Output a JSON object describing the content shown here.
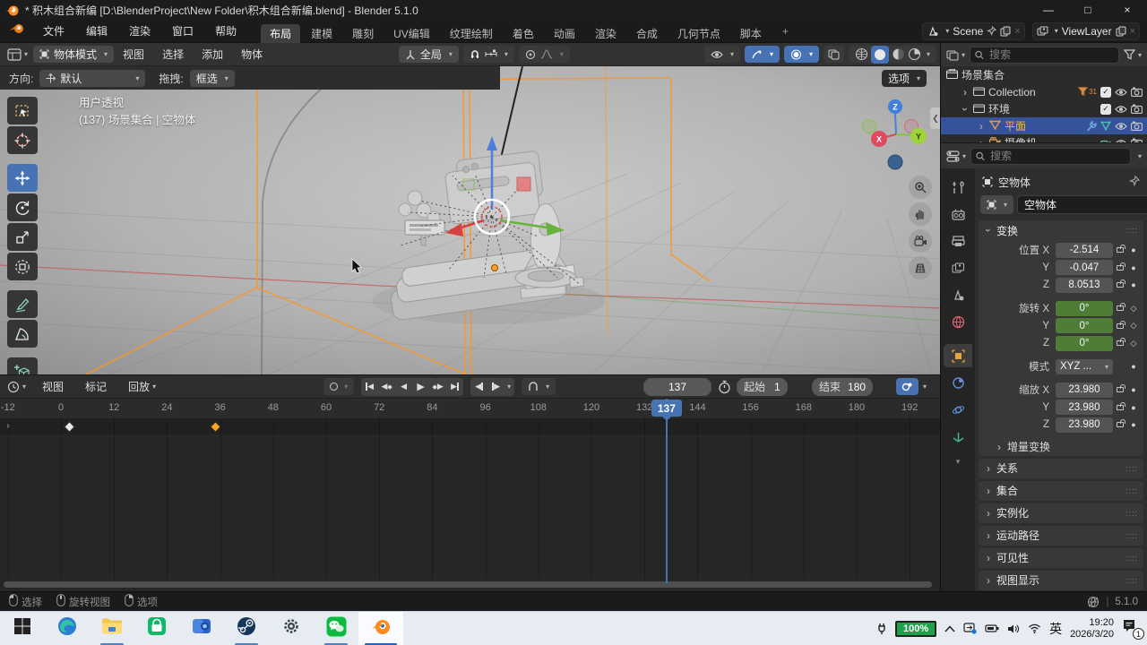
{
  "icons": {
    "minimize": "—",
    "maximize": "□",
    "close": "×",
    "chevron": "▾",
    "expand": "›",
    "check": "✓",
    "dot": "●",
    "diamond": "◇",
    "grip": "::::",
    "collapse_left": "❮"
  },
  "window": {
    "title": "* 积木组合新编 [D:\\BlenderProject\\New Folder\\积木组合新编.blend] - Blender 5.1.0"
  },
  "topbar": {
    "menus": [
      "文件",
      "编辑",
      "渲染",
      "窗口",
      "帮助"
    ],
    "workspaces": [
      "布局",
      "建模",
      "雕刻",
      "UV编辑",
      "纹理绘制",
      "着色",
      "动画",
      "渲染",
      "合成",
      "几何节点",
      "脚本"
    ],
    "active_workspace": "布局",
    "add_workspace": "+",
    "scene_label": "Scene",
    "viewlayer_label": "ViewLayer"
  },
  "viewport": {
    "mode": "物体模式",
    "menus": [
      "视图",
      "选择",
      "添加",
      "物体"
    ],
    "orientation": "全局",
    "toolsettings": {
      "direction_label": "方向:",
      "direction_value": "默认",
      "drag_label": "拖拽:",
      "drag_value": "框选"
    },
    "options_button": "选项",
    "overlay_line1": "用户透视",
    "overlay_line2": "(137) 场景集合 | 空物体",
    "tools": [
      "box-select",
      "cursor",
      "move",
      "rotate",
      "scale",
      "transform",
      "annotate",
      "measure",
      "add-cube"
    ],
    "active_tool": "move",
    "axis_labels": {
      "x": "X",
      "y": "Y",
      "z": "Z"
    }
  },
  "outliner": {
    "search_placeholder": "搜索",
    "rows": [
      {
        "label": "场景集合",
        "type": "scene-collection",
        "depth": 0,
        "expand": "none"
      },
      {
        "label": "Collection",
        "type": "collection",
        "depth": 1,
        "expand": "right",
        "badge": "31",
        "checkbox": true,
        "eye": true,
        "camera": true
      },
      {
        "label": "环境",
        "type": "collection",
        "depth": 1,
        "expand": "down",
        "checkbox": true,
        "eye": true,
        "camera": true
      },
      {
        "label": "平面",
        "type": "mesh",
        "depth": 2,
        "expand": "right",
        "selected": true,
        "modifier": true,
        "data": true,
        "eye": true,
        "camera": true
      },
      {
        "label": "摄像机",
        "type": "camera",
        "depth": 2,
        "expand": "right",
        "data": true,
        "eye": true,
        "camera": true
      }
    ]
  },
  "properties": {
    "search_placeholder": "搜索",
    "breadcrumb": "空物体",
    "name_value": "空物体",
    "tabs": [
      "tool",
      "render",
      "output",
      "view-layer",
      "scene",
      "world",
      "object",
      "constraints",
      "physics",
      "data"
    ],
    "active_tab": "object",
    "transform": {
      "title": "变换",
      "location_label": "位置",
      "rotation_label": "旋转",
      "scale_label": "缩放",
      "mode_label": "模式",
      "axis_x": "X",
      "axis_y": "Y",
      "axis_z": "Z",
      "location": [
        "-2.514",
        "-0.047",
        "8.0513"
      ],
      "rotation": [
        "0°",
        "0°",
        "0°"
      ],
      "mode_value": "XYZ ...",
      "scale": [
        "23.980",
        "23.980",
        "23.980"
      ],
      "delta_label": "增量变换"
    },
    "panels": [
      "关系",
      "集合",
      "实例化",
      "运动路径",
      "可见性",
      "视图显示"
    ]
  },
  "timeline": {
    "menus": [
      "视图",
      "标记",
      "回放"
    ],
    "current_frame": "137",
    "start_label": "起始",
    "start_value": "1",
    "end_label": "结束",
    "end_value": "180",
    "ticks": [
      -12,
      0,
      12,
      24,
      36,
      48,
      60,
      72,
      84,
      96,
      108,
      120,
      132,
      144,
      156,
      168,
      180,
      192
    ],
    "keyframes": [
      {
        "frame": 2,
        "color": "#e8e8e8"
      },
      {
        "frame": 35,
        "color": "#f5a623"
      }
    ],
    "playhead_frame": 137
  },
  "statusbar": {
    "hints": [
      {
        "button": "left",
        "label": "选择"
      },
      {
        "button": "middle",
        "label": "旋转视图"
      },
      {
        "button": "right",
        "label": "选项"
      }
    ],
    "version": "5.1.0"
  },
  "taskbar": {
    "apps": [
      "start",
      "edge",
      "explorer",
      "store",
      "photos",
      "steam",
      "settings",
      "wechat",
      "blender"
    ],
    "active_app": "blender",
    "running_apps": [
      "explorer",
      "steam",
      "wechat",
      "blender"
    ],
    "tray": {
      "battery": "100%",
      "ime": "英",
      "time": "19:20",
      "date": "2026/3/20",
      "notification_count": "1"
    }
  }
}
